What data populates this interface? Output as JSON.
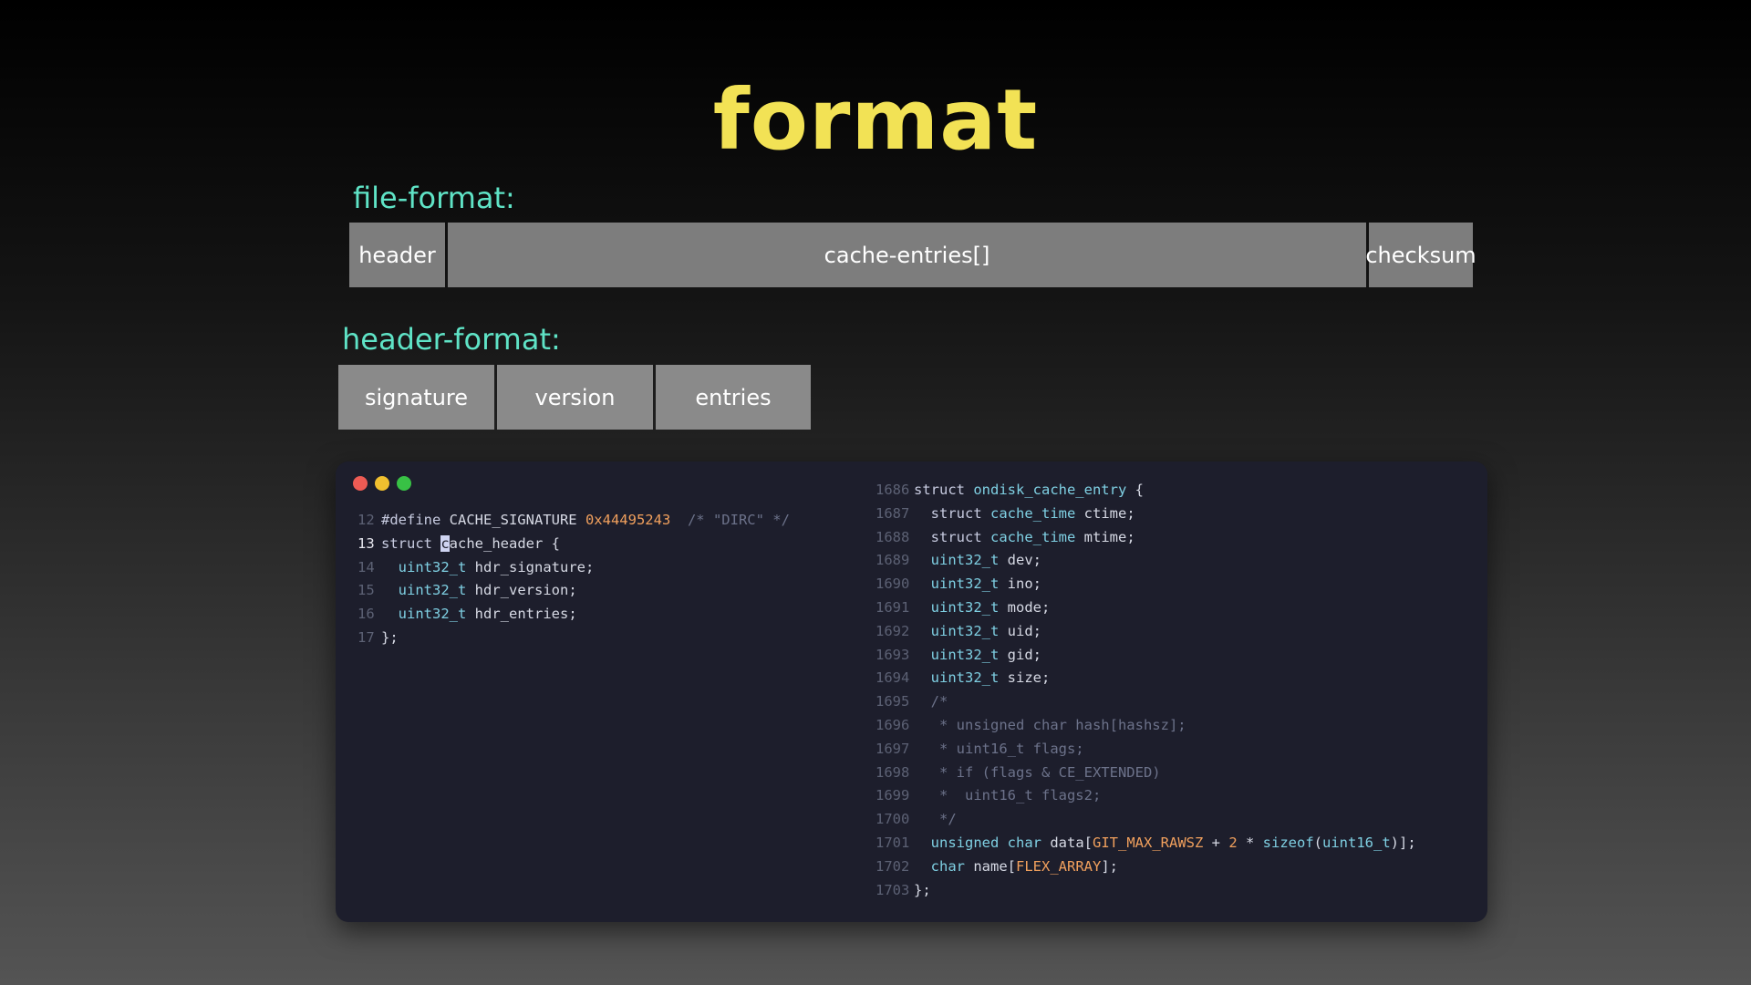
{
  "title": "format",
  "file_format": {
    "label": "file-format:",
    "fields": [
      "header",
      "cache-entries[]",
      "checksum"
    ]
  },
  "header_format": {
    "label": "header-format:",
    "fields": [
      "signature",
      "version",
      "entries"
    ]
  },
  "window": {
    "controls": {
      "close_color": "#ed5b54",
      "minimize_color": "#f1c02f",
      "maximize_color": "#38c145"
    },
    "left_code": [
      {
        "n": "12",
        "t": [
          [
            "kw",
            "#define "
          ],
          [
            "",
            "CACHE_SIGNATURE "
          ],
          [
            "num",
            "0x44495243"
          ],
          [
            "",
            "  "
          ],
          [
            "cm",
            "/* \"DIRC\" */"
          ]
        ]
      },
      {
        "n": "13",
        "current": true,
        "t": [
          [
            "kw",
            "struct "
          ],
          [
            "cursor",
            "c"
          ],
          [
            "",
            "ache_header {"
          ]
        ]
      },
      {
        "n": "14",
        "t": [
          [
            "",
            "  "
          ],
          [
            "ty",
            "uint32_t "
          ],
          [
            "",
            "hdr_signature;"
          ]
        ]
      },
      {
        "n": "15",
        "t": [
          [
            "",
            "  "
          ],
          [
            "ty",
            "uint32_t "
          ],
          [
            "",
            "hdr_version;"
          ]
        ]
      },
      {
        "n": "16",
        "t": [
          [
            "",
            "  "
          ],
          [
            "ty",
            "uint32_t "
          ],
          [
            "",
            "hdr_entries;"
          ]
        ]
      },
      {
        "n": "17",
        "t": [
          [
            "",
            "};"
          ]
        ]
      }
    ],
    "right_code": [
      {
        "n": "1686",
        "t": [
          [
            "kw",
            "struct "
          ],
          [
            "ty",
            "ondisk_cache_entry "
          ],
          [
            "",
            "{"
          ]
        ]
      },
      {
        "n": "1687",
        "t": [
          [
            "",
            "  "
          ],
          [
            "kw",
            "struct "
          ],
          [
            "ty",
            "cache_time "
          ],
          [
            "",
            "ctime;"
          ]
        ]
      },
      {
        "n": "1688",
        "t": [
          [
            "",
            "  "
          ],
          [
            "kw",
            "struct "
          ],
          [
            "ty",
            "cache_time "
          ],
          [
            "",
            "mtime;"
          ]
        ]
      },
      {
        "n": "1689",
        "t": [
          [
            "",
            "  "
          ],
          [
            "ty",
            "uint32_t "
          ],
          [
            "",
            "dev;"
          ]
        ]
      },
      {
        "n": "1690",
        "t": [
          [
            "",
            "  "
          ],
          [
            "ty",
            "uint32_t "
          ],
          [
            "",
            "ino;"
          ]
        ]
      },
      {
        "n": "1691",
        "t": [
          [
            "",
            "  "
          ],
          [
            "ty",
            "uint32_t "
          ],
          [
            "",
            "mode;"
          ]
        ]
      },
      {
        "n": "1692",
        "t": [
          [
            "",
            "  "
          ],
          [
            "ty",
            "uint32_t "
          ],
          [
            "",
            "uid;"
          ]
        ]
      },
      {
        "n": "1693",
        "t": [
          [
            "",
            "  "
          ],
          [
            "ty",
            "uint32_t "
          ],
          [
            "",
            "gid;"
          ]
        ]
      },
      {
        "n": "1694",
        "t": [
          [
            "",
            "  "
          ],
          [
            "ty",
            "uint32_t "
          ],
          [
            "",
            "size;"
          ]
        ]
      },
      {
        "n": "1695",
        "t": [
          [
            "",
            "  "
          ],
          [
            "cm",
            "/*"
          ]
        ]
      },
      {
        "n": "1696",
        "t": [
          [
            "",
            "  "
          ],
          [
            "cm",
            " * unsigned char hash[hashsz];"
          ]
        ]
      },
      {
        "n": "1697",
        "t": [
          [
            "",
            "  "
          ],
          [
            "cm",
            " * uint16_t flags;"
          ]
        ]
      },
      {
        "n": "1698",
        "t": [
          [
            "",
            "  "
          ],
          [
            "cm",
            " * if (flags & CE_EXTENDED)"
          ]
        ]
      },
      {
        "n": "1699",
        "t": [
          [
            "",
            "  "
          ],
          [
            "cm",
            " *  uint16_t flags2;"
          ]
        ]
      },
      {
        "n": "1700",
        "t": [
          [
            "",
            "  "
          ],
          [
            "cm",
            " */"
          ]
        ]
      },
      {
        "n": "1701",
        "t": [
          [
            "",
            "  "
          ],
          [
            "ty",
            "unsigned char "
          ],
          [
            "",
            "data["
          ],
          [
            "num",
            "GIT_MAX_RAWSZ"
          ],
          [
            "",
            " + "
          ],
          [
            "num",
            "2"
          ],
          [
            "",
            " * "
          ],
          [
            "ty",
            "sizeof"
          ],
          [
            "",
            "("
          ],
          [
            "ty",
            "uint16_t"
          ],
          [
            "",
            ")];"
          ]
        ]
      },
      {
        "n": "1702",
        "t": [
          [
            "",
            "  "
          ],
          [
            "ty",
            "char "
          ],
          [
            "",
            "name["
          ],
          [
            "num",
            "FLEX_ARRAY"
          ],
          [
            "",
            "];"
          ]
        ]
      },
      {
        "n": "1703",
        "t": [
          [
            "",
            "};"
          ]
        ]
      }
    ]
  }
}
